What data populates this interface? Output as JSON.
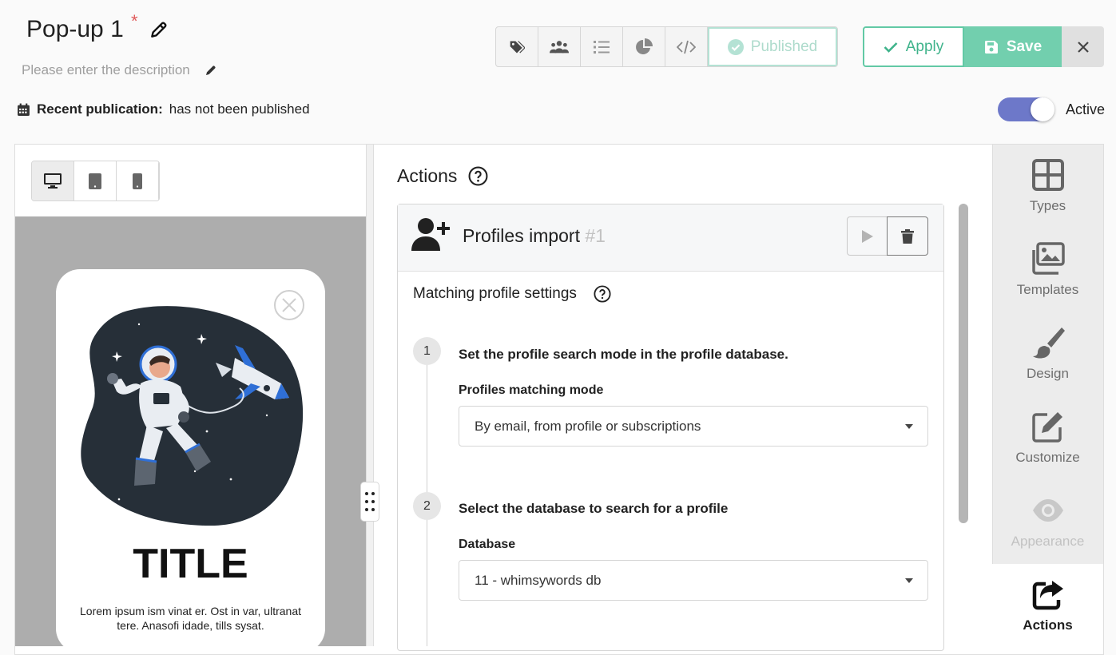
{
  "header": {
    "title": "Pop-up 1",
    "modified_marker": "*",
    "description_placeholder": "Please enter the description",
    "recent_publication_label": "Recent publication:",
    "recent_publication_value": "has not been published"
  },
  "toolbar": {
    "icons": [
      "tags-icon",
      "users-icon",
      "list-icon",
      "pie-chart-icon",
      "code-icon"
    ],
    "published_label": "Published",
    "apply_label": "Apply",
    "save_label": "Save"
  },
  "status": {
    "active_label": "Active",
    "active": true
  },
  "preview": {
    "devices": [
      "desktop-icon",
      "tablet-icon",
      "mobile-icon"
    ],
    "selected_device": "desktop",
    "popup_title": "TITLE",
    "popup_body": "Lorem ipsum ism vinat er. Ost in var, ultranat tere. Anasofi idade, tills sysat."
  },
  "actions": {
    "title": "Actions",
    "card": {
      "title": "Profiles import",
      "number": "#1",
      "section_title": "Matching profile settings",
      "steps": [
        {
          "number": "1",
          "title": "Set the profile search mode in the profile database.",
          "field_label": "Profiles matching mode",
          "field_value": "By email, from profile or subscriptions"
        },
        {
          "number": "2",
          "title": "Select the database to search for a profile",
          "field_label": "Database",
          "field_value": "11 - whimsywords db"
        }
      ]
    }
  },
  "sidebar": {
    "items": [
      {
        "label": "Types",
        "icon": "grid-icon"
      },
      {
        "label": "Templates",
        "icon": "images-icon"
      },
      {
        "label": "Design",
        "icon": "brush-icon"
      },
      {
        "label": "Customize",
        "icon": "edit-icon"
      },
      {
        "label": "Appearance",
        "icon": "eye-icon"
      },
      {
        "label": "Actions",
        "icon": "share-icon"
      }
    ],
    "selected": "Actions"
  },
  "colors": {
    "accent_green": "#72cfae",
    "toggle_blue": "#6d78c9",
    "required_red": "#e05a5a"
  }
}
